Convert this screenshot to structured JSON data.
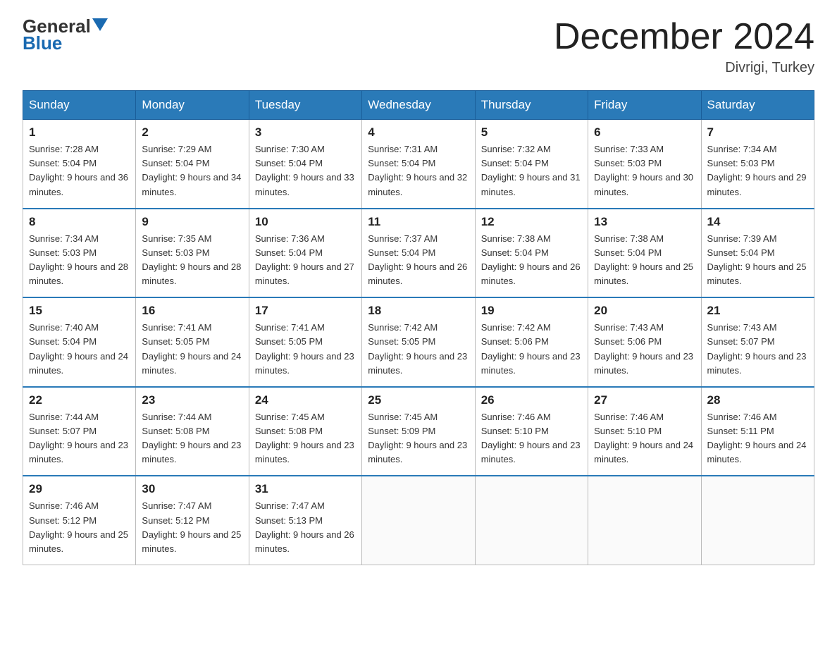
{
  "header": {
    "logo_general": "General",
    "logo_blue": "Blue",
    "month_title": "December 2024",
    "location": "Divrigi, Turkey"
  },
  "weekdays": [
    "Sunday",
    "Monday",
    "Tuesday",
    "Wednesday",
    "Thursday",
    "Friday",
    "Saturday"
  ],
  "weeks": [
    [
      {
        "day": "1",
        "sunrise": "7:28 AM",
        "sunset": "5:04 PM",
        "daylight": "9 hours and 36 minutes."
      },
      {
        "day": "2",
        "sunrise": "7:29 AM",
        "sunset": "5:04 PM",
        "daylight": "9 hours and 34 minutes."
      },
      {
        "day": "3",
        "sunrise": "7:30 AM",
        "sunset": "5:04 PM",
        "daylight": "9 hours and 33 minutes."
      },
      {
        "day": "4",
        "sunrise": "7:31 AM",
        "sunset": "5:04 PM",
        "daylight": "9 hours and 32 minutes."
      },
      {
        "day": "5",
        "sunrise": "7:32 AM",
        "sunset": "5:04 PM",
        "daylight": "9 hours and 31 minutes."
      },
      {
        "day": "6",
        "sunrise": "7:33 AM",
        "sunset": "5:03 PM",
        "daylight": "9 hours and 30 minutes."
      },
      {
        "day": "7",
        "sunrise": "7:34 AM",
        "sunset": "5:03 PM",
        "daylight": "9 hours and 29 minutes."
      }
    ],
    [
      {
        "day": "8",
        "sunrise": "7:34 AM",
        "sunset": "5:03 PM",
        "daylight": "9 hours and 28 minutes."
      },
      {
        "day": "9",
        "sunrise": "7:35 AM",
        "sunset": "5:03 PM",
        "daylight": "9 hours and 28 minutes."
      },
      {
        "day": "10",
        "sunrise": "7:36 AM",
        "sunset": "5:04 PM",
        "daylight": "9 hours and 27 minutes."
      },
      {
        "day": "11",
        "sunrise": "7:37 AM",
        "sunset": "5:04 PM",
        "daylight": "9 hours and 26 minutes."
      },
      {
        "day": "12",
        "sunrise": "7:38 AM",
        "sunset": "5:04 PM",
        "daylight": "9 hours and 26 minutes."
      },
      {
        "day": "13",
        "sunrise": "7:38 AM",
        "sunset": "5:04 PM",
        "daylight": "9 hours and 25 minutes."
      },
      {
        "day": "14",
        "sunrise": "7:39 AM",
        "sunset": "5:04 PM",
        "daylight": "9 hours and 25 minutes."
      }
    ],
    [
      {
        "day": "15",
        "sunrise": "7:40 AM",
        "sunset": "5:04 PM",
        "daylight": "9 hours and 24 minutes."
      },
      {
        "day": "16",
        "sunrise": "7:41 AM",
        "sunset": "5:05 PM",
        "daylight": "9 hours and 24 minutes."
      },
      {
        "day": "17",
        "sunrise": "7:41 AM",
        "sunset": "5:05 PM",
        "daylight": "9 hours and 23 minutes."
      },
      {
        "day": "18",
        "sunrise": "7:42 AM",
        "sunset": "5:05 PM",
        "daylight": "9 hours and 23 minutes."
      },
      {
        "day": "19",
        "sunrise": "7:42 AM",
        "sunset": "5:06 PM",
        "daylight": "9 hours and 23 minutes."
      },
      {
        "day": "20",
        "sunrise": "7:43 AM",
        "sunset": "5:06 PM",
        "daylight": "9 hours and 23 minutes."
      },
      {
        "day": "21",
        "sunrise": "7:43 AM",
        "sunset": "5:07 PM",
        "daylight": "9 hours and 23 minutes."
      }
    ],
    [
      {
        "day": "22",
        "sunrise": "7:44 AM",
        "sunset": "5:07 PM",
        "daylight": "9 hours and 23 minutes."
      },
      {
        "day": "23",
        "sunrise": "7:44 AM",
        "sunset": "5:08 PM",
        "daylight": "9 hours and 23 minutes."
      },
      {
        "day": "24",
        "sunrise": "7:45 AM",
        "sunset": "5:08 PM",
        "daylight": "9 hours and 23 minutes."
      },
      {
        "day": "25",
        "sunrise": "7:45 AM",
        "sunset": "5:09 PM",
        "daylight": "9 hours and 23 minutes."
      },
      {
        "day": "26",
        "sunrise": "7:46 AM",
        "sunset": "5:10 PM",
        "daylight": "9 hours and 23 minutes."
      },
      {
        "day": "27",
        "sunrise": "7:46 AM",
        "sunset": "5:10 PM",
        "daylight": "9 hours and 24 minutes."
      },
      {
        "day": "28",
        "sunrise": "7:46 AM",
        "sunset": "5:11 PM",
        "daylight": "9 hours and 24 minutes."
      }
    ],
    [
      {
        "day": "29",
        "sunrise": "7:46 AM",
        "sunset": "5:12 PM",
        "daylight": "9 hours and 25 minutes."
      },
      {
        "day": "30",
        "sunrise": "7:47 AM",
        "sunset": "5:12 PM",
        "daylight": "9 hours and 25 minutes."
      },
      {
        "day": "31",
        "sunrise": "7:47 AM",
        "sunset": "5:13 PM",
        "daylight": "9 hours and 26 minutes."
      },
      null,
      null,
      null,
      null
    ]
  ]
}
